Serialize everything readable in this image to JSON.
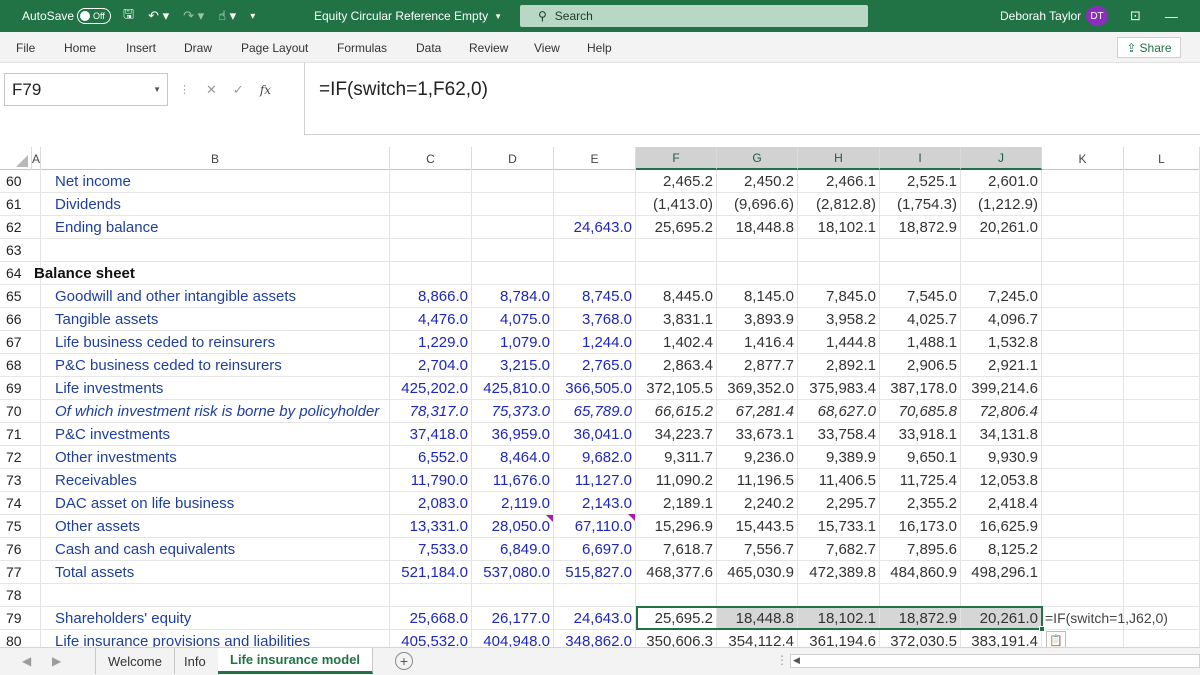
{
  "titlebar": {
    "autosave": "AutoSave",
    "toggle": "Off",
    "save_icon": "save-icon",
    "undo_icon": "undo-icon",
    "redo_icon": "redo-icon",
    "doc_title": "Equity Circular Reference Empty",
    "search_placeholder": "Search",
    "user": "Deborah Taylor",
    "initials": "DT"
  },
  "ribbon": {
    "tabs": [
      "File",
      "Home",
      "Insert",
      "Draw",
      "Page Layout",
      "Formulas",
      "Data",
      "Review",
      "View",
      "Help"
    ],
    "share": "Share"
  },
  "formula_bar": {
    "name_box": "F79",
    "cancel": "✕",
    "enter": "✓",
    "fx": "fx",
    "formula": "=IF(switch=1,F62,0)"
  },
  "columns": [
    "A",
    "B",
    "C",
    "D",
    "E",
    "F",
    "G",
    "H",
    "I",
    "J",
    "K",
    "L"
  ],
  "rows": [
    {
      "n": "60",
      "label": "Net income",
      "c": "",
      "d": "",
      "e": "",
      "f": "2,465.2",
      "g": "2,450.2",
      "h": "2,466.1",
      "i": "2,525.1",
      "j": "2,601.0"
    },
    {
      "n": "61",
      "label": "Dividends",
      "c": "",
      "d": "",
      "e": "",
      "f": "(1,413.0)",
      "g": "(9,696.6)",
      "h": "(2,812.8)",
      "i": "(1,754.3)",
      "j": "(1,212.9)"
    },
    {
      "n": "62",
      "label": "Ending balance",
      "c": "",
      "d": "",
      "e": "24,643.0",
      "f": "25,695.2",
      "g": "18,448.8",
      "h": "18,102.1",
      "i": "18,872.9",
      "j": "20,261.0"
    },
    {
      "n": "63",
      "label": "",
      "c": "",
      "d": "",
      "e": "",
      "f": "",
      "g": "",
      "h": "",
      "i": "",
      "j": ""
    },
    {
      "n": "64",
      "label": "Balance sheet",
      "c": "",
      "d": "",
      "e": "",
      "f": "",
      "g": "",
      "h": "",
      "i": "",
      "j": ""
    },
    {
      "n": "65",
      "label": "Goodwill and other intangible assets",
      "c": "8,866.0",
      "d": "8,784.0",
      "e": "8,745.0",
      "f": "8,445.0",
      "g": "8,145.0",
      "h": "7,845.0",
      "i": "7,545.0",
      "j": "7,245.0"
    },
    {
      "n": "66",
      "label": "Tangible assets",
      "c": "4,476.0",
      "d": "4,075.0",
      "e": "3,768.0",
      "f": "3,831.1",
      "g": "3,893.9",
      "h": "3,958.2",
      "i": "4,025.7",
      "j": "4,096.7"
    },
    {
      "n": "67",
      "label": "Life business ceded to reinsurers",
      "c": "1,229.0",
      "d": "1,079.0",
      "e": "1,244.0",
      "f": "1,402.4",
      "g": "1,416.4",
      "h": "1,444.8",
      "i": "1,488.1",
      "j": "1,532.8"
    },
    {
      "n": "68",
      "label": "P&C business ceded to reinsurers",
      "c": "2,704.0",
      "d": "3,215.0",
      "e": "2,765.0",
      "f": "2,863.4",
      "g": "2,877.7",
      "h": "2,892.1",
      "i": "2,906.5",
      "j": "2,921.1"
    },
    {
      "n": "69",
      "label": "Life investments",
      "c": "425,202.0",
      "d": "425,810.0",
      "e": "366,505.0",
      "f": "372,105.5",
      "g": "369,352.0",
      "h": "375,983.4",
      "i": "387,178.0",
      "j": "399,214.6"
    },
    {
      "n": "70",
      "label": "Of which investment risk is borne by policyholder",
      "c": "78,317.0",
      "d": "75,373.0",
      "e": "65,789.0",
      "f": "66,615.2",
      "g": "67,281.4",
      "h": "68,627.0",
      "i": "70,685.8",
      "j": "72,806.4"
    },
    {
      "n": "71",
      "label": "P&C investments",
      "c": "37,418.0",
      "d": "36,959.0",
      "e": "36,041.0",
      "f": "34,223.7",
      "g": "33,673.1",
      "h": "33,758.4",
      "i": "33,918.1",
      "j": "34,131.8"
    },
    {
      "n": "72",
      "label": "Other investments",
      "c": "6,552.0",
      "d": "8,464.0",
      "e": "9,682.0",
      "f": "9,311.7",
      "g": "9,236.0",
      "h": "9,389.9",
      "i": "9,650.1",
      "j": "9,930.9"
    },
    {
      "n": "73",
      "label": "Receivables",
      "c": "11,790.0",
      "d": "11,676.0",
      "e": "11,127.0",
      "f": "11,090.2",
      "g": "11,196.5",
      "h": "11,406.5",
      "i": "11,725.4",
      "j": "12,053.8"
    },
    {
      "n": "74",
      "label": "DAC asset on life business",
      "c": "2,083.0",
      "d": "2,119.0",
      "e": "2,143.0",
      "f": "2,189.1",
      "g": "2,240.2",
      "h": "2,295.7",
      "i": "2,355.2",
      "j": "2,418.4"
    },
    {
      "n": "75",
      "label": "Other assets",
      "c": "13,331.0",
      "d": "28,050.0",
      "e": "67,110.0",
      "f": "15,296.9",
      "g": "15,443.5",
      "h": "15,733.1",
      "i": "16,173.0",
      "j": "16,625.9"
    },
    {
      "n": "76",
      "label": "Cash and cash equivalents",
      "c": "7,533.0",
      "d": "6,849.0",
      "e": "6,697.0",
      "f": "7,618.7",
      "g": "7,556.7",
      "h": "7,682.7",
      "i": "7,895.6",
      "j": "8,125.2"
    },
    {
      "n": "77",
      "label": "Total assets",
      "c": "521,184.0",
      "d": "537,080.0",
      "e": "515,827.0",
      "f": "468,377.6",
      "g": "465,030.9",
      "h": "472,389.8",
      "i": "484,860.9",
      "j": "498,296.1"
    },
    {
      "n": "78",
      "label": "",
      "c": "",
      "d": "",
      "e": "",
      "f": "",
      "g": "",
      "h": "",
      "i": "",
      "j": ""
    },
    {
      "n": "79",
      "label": "Shareholders' equity",
      "c": "25,668.0",
      "d": "26,177.0",
      "e": "24,643.0",
      "f": "25,695.2",
      "g": "18,448.8",
      "h": "18,102.1",
      "i": "18,872.9",
      "j": "20,261.0"
    },
    {
      "n": "80",
      "label": "Life insurance provisions and liabilities",
      "c": "405,532.0",
      "d": "404,948.0",
      "e": "348,862.0",
      "f": "350,606.3",
      "g": "354,112.4",
      "h": "361,194.6",
      "i": "372,030.5",
      "j": "383,191.4"
    }
  ],
  "k79_formula": "=IF(switch=1,J62,0)",
  "sheet_tabs": [
    "Welcome",
    "Info",
    "Life insurance model"
  ],
  "active_sheet": "Life insurance model",
  "colors": {
    "accent": "#217346",
    "historical": "#1d27b8",
    "label": "#1f3f9c",
    "comment": "#a31ea3"
  }
}
